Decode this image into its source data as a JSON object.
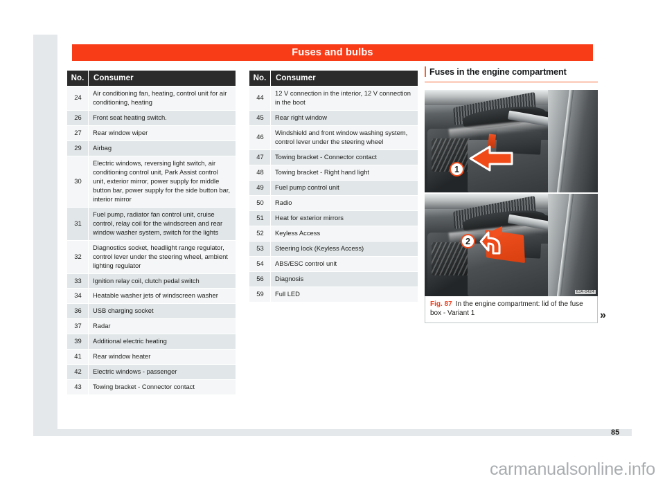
{
  "banner": {
    "title": "Fuses and bulbs"
  },
  "tables": {
    "headers": {
      "no": "No.",
      "consumer": "Consumer"
    },
    "left_rows": [
      {
        "no": "24",
        "consumer": "Air conditioning fan, heating, control unit for air conditioning, heating"
      },
      {
        "no": "26",
        "consumer": "Front seat heating switch."
      },
      {
        "no": "27",
        "consumer": "Rear window wiper"
      },
      {
        "no": "29",
        "consumer": "Airbag"
      },
      {
        "no": "30",
        "consumer": "Electric windows, reversing light switch, air conditioning control unit, Park Assist control unit, exterior mirror, power supply for middle button bar, power supply for the side button bar, interior mirror"
      },
      {
        "no": "31",
        "consumer": "Fuel pump, radiator fan control unit, cruise control, relay coil for the windscreen and rear window washer system, switch for the lights"
      },
      {
        "no": "32",
        "consumer": "Diagnostics socket, headlight range regulator, control lever under the steering wheel, ambient lighting regulator"
      },
      {
        "no": "33",
        "consumer": "Ignition relay coil, clutch pedal switch"
      },
      {
        "no": "34",
        "consumer": "Heatable washer jets of windscreen washer"
      },
      {
        "no": "36",
        "consumer": "USB charging socket"
      },
      {
        "no": "37",
        "consumer": "Radar"
      },
      {
        "no": "39",
        "consumer": "Additional electric heating"
      },
      {
        "no": "41",
        "consumer": "Rear window heater"
      },
      {
        "no": "42",
        "consumer": "Electric windows - passenger"
      },
      {
        "no": "43",
        "consumer": "Towing bracket - Connector contact"
      }
    ],
    "right_rows": [
      {
        "no": "44",
        "consumer": "12 V connection in the interior, 12 V connection in the boot"
      },
      {
        "no": "45",
        "consumer": "Rear right window"
      },
      {
        "no": "46",
        "consumer": "Windshield and front window washing system, control lever under the steering wheel"
      },
      {
        "no": "47",
        "consumer": "Towing bracket - Connector contact"
      },
      {
        "no": "48",
        "consumer": "Towing bracket - Right hand light"
      },
      {
        "no": "49",
        "consumer": "Fuel pump control unit"
      },
      {
        "no": "50",
        "consumer": "Radio"
      },
      {
        "no": "51",
        "consumer": "Heat for exterior mirrors"
      },
      {
        "no": "52",
        "consumer": "Keyless Access"
      },
      {
        "no": "53",
        "consumer": "Steering lock (Keyless Access)"
      },
      {
        "no": "54",
        "consumer": "ABS/ESC control unit"
      },
      {
        "no": "56",
        "consumer": "Diagnosis"
      },
      {
        "no": "59",
        "consumer": "Full LED"
      }
    ]
  },
  "right_column": {
    "section_heading": "Fuses in the engine compartment",
    "figure": {
      "callout_1": "1",
      "callout_2": "2",
      "image_watermark": "6JA-0424",
      "caption_label": "Fig. 87",
      "caption_text": "In the engine compartment: lid of the fuse box - Variant 1"
    },
    "continuation_arrow": "»"
  },
  "page_number": "85",
  "bottom_watermark": "carmanualsonline.info",
  "colors": {
    "banner_red": "#f93c18",
    "accent_orange": "#f4622e",
    "header_dark": "#2b2b2b",
    "row_light": "#f4f6f7",
    "row_dark": "#e1e6e8",
    "page_margin": "#e4e8ea"
  }
}
